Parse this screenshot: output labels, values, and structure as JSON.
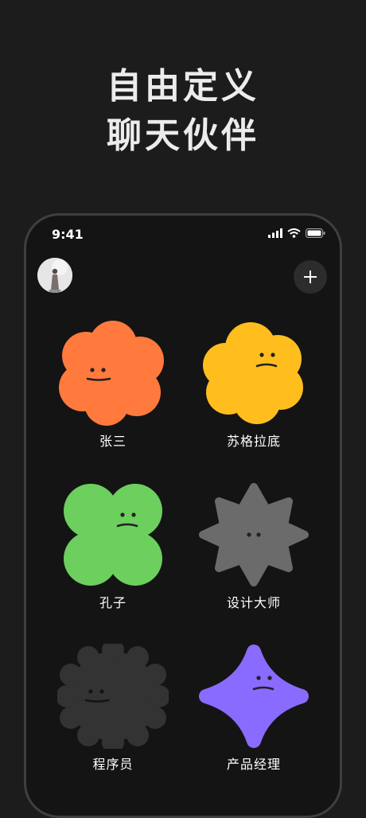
{
  "headline": {
    "line1": "自由定义",
    "line2": "聊天伙伴"
  },
  "status_bar": {
    "time": "9:41"
  },
  "characters": [
    {
      "name": "张三",
      "color": "#ff7a3c",
      "shape": "flower-icon"
    },
    {
      "name": "苏格拉底",
      "color": "#ffbe1e",
      "shape": "cloud-icon"
    },
    {
      "name": "孔子",
      "color": "#6ccf5e",
      "shape": "clover-icon"
    },
    {
      "name": "设计大师",
      "color": "#6b6b6b",
      "shape": "star-burst-icon"
    },
    {
      "name": "程序员",
      "color": "#333333",
      "shape": "gear-icon"
    },
    {
      "name": "产品经理",
      "color": "#8a6bff",
      "shape": "sparkle-icon"
    }
  ],
  "colors": {
    "background": "#1c1c1c",
    "phone_screen": "#141414",
    "accent": "#ffffff"
  }
}
